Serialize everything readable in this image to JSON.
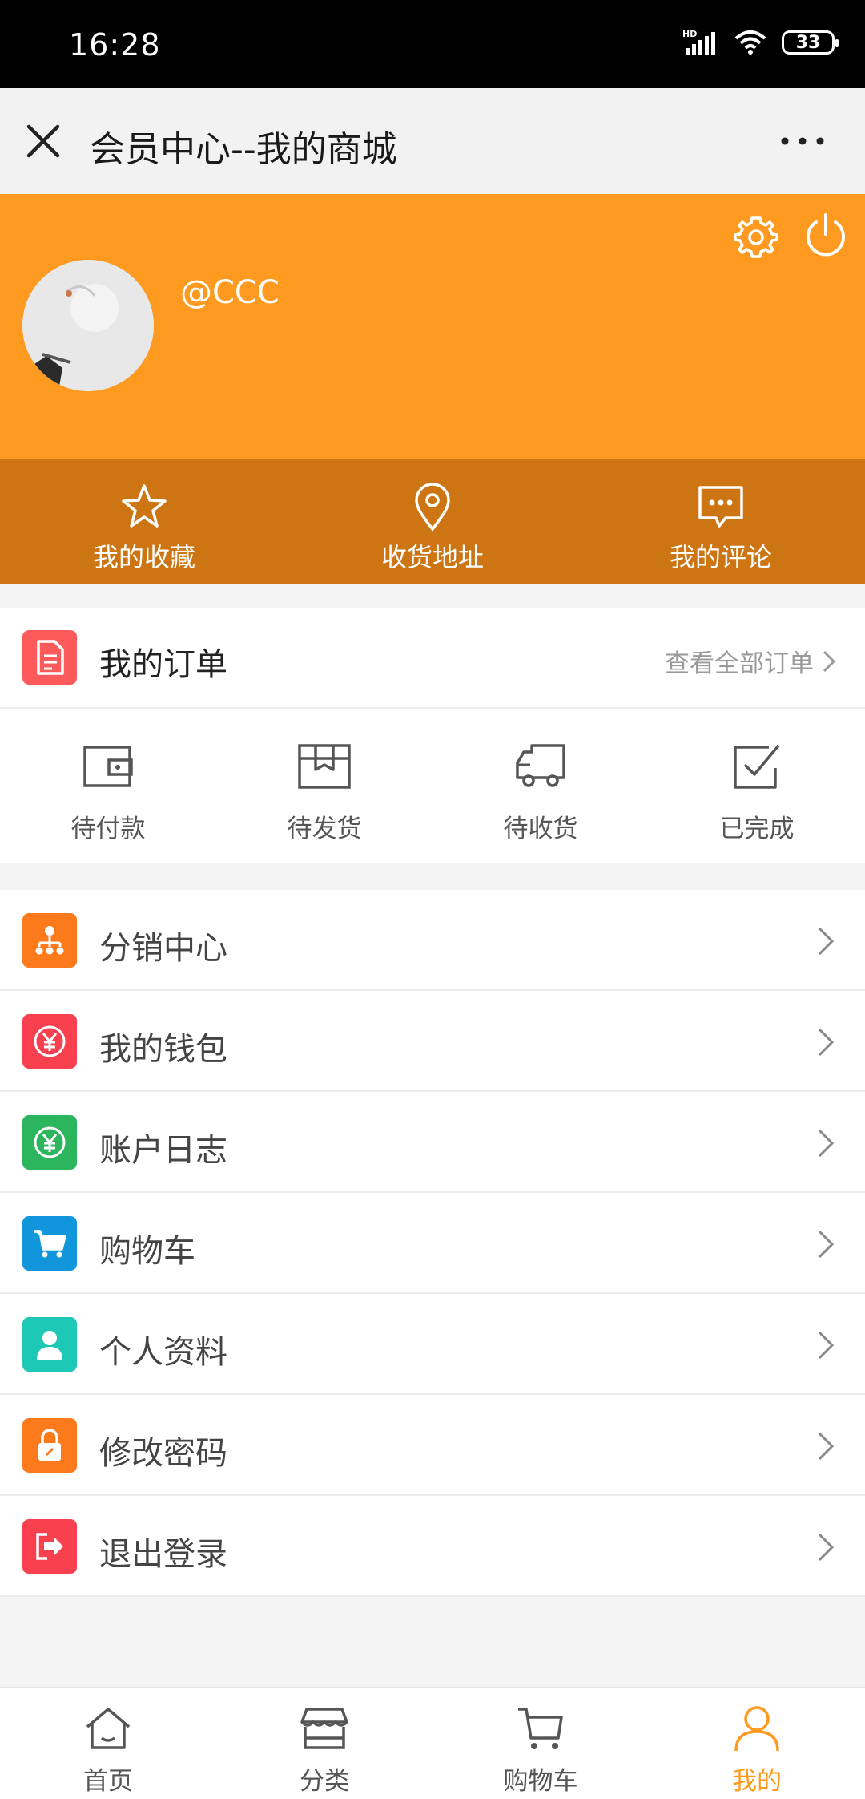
{
  "status_bar": {
    "time": "16:28",
    "battery": "33"
  },
  "header": {
    "title": "会员中心--我的商城"
  },
  "profile": {
    "username": "@CCC"
  },
  "quick_links": [
    {
      "label": "我的收藏",
      "icon": "star-icon"
    },
    {
      "label": "收货地址",
      "icon": "location-pin-icon"
    },
    {
      "label": "我的评论",
      "icon": "comment-icon"
    }
  ],
  "orders": {
    "title": "我的订单",
    "view_all": "查看全部订单",
    "statuses": [
      {
        "label": "待付款",
        "icon": "wallet-icon"
      },
      {
        "label": "待发货",
        "icon": "box-icon"
      },
      {
        "label": "待收货",
        "icon": "truck-icon"
      },
      {
        "label": "已完成",
        "icon": "check-square-icon"
      }
    ]
  },
  "menu": [
    {
      "label": "分销中心",
      "icon": "distribution-icon",
      "color": "#fd7a1c"
    },
    {
      "label": "我的钱包",
      "icon": "yuan-icon",
      "color": "#f9404e"
    },
    {
      "label": "账户日志",
      "icon": "yuan-circle-icon",
      "color": "#2db55d"
    },
    {
      "label": "购物车",
      "icon": "cart-icon",
      "color": "#1296db"
    },
    {
      "label": "个人资料",
      "icon": "person-icon",
      "color": "#1dc8b6"
    },
    {
      "label": "修改密码",
      "icon": "lock-icon",
      "color": "#fd7a1c"
    },
    {
      "label": "退出登录",
      "icon": "logout-icon",
      "color": "#f9404e"
    }
  ],
  "tabbar": [
    {
      "label": "首页",
      "icon": "home-icon"
    },
    {
      "label": "分类",
      "icon": "store-icon"
    },
    {
      "label": "购物车",
      "icon": "cart-icon"
    },
    {
      "label": "我的",
      "icon": "user-icon",
      "active": true
    }
  ],
  "colors": {
    "accent": "#fe9a1f",
    "accent_dark": "#cc7512"
  }
}
